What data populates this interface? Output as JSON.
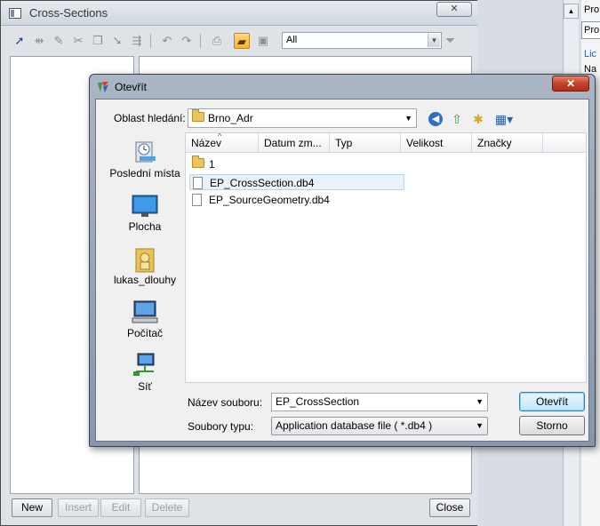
{
  "bg_window": {
    "title": "Cross-Sections",
    "close_glyph": "✕",
    "filter_value": "All",
    "buttons": {
      "new": "New",
      "insert": "Insert",
      "edit": "Edit",
      "delete": "Delete",
      "close": "Close"
    }
  },
  "right_panel": {
    "items": [
      "Pro",
      "Pro",
      "Lic",
      "Na"
    ]
  },
  "dialog": {
    "title": "Otevřít",
    "close_glyph": "✕",
    "look_in_label": "Oblast hledání:",
    "look_in_value": "Brno_Adr",
    "places": [
      {
        "label": "Poslední místa",
        "icon": "recent-places-icon"
      },
      {
        "label": "Plocha",
        "icon": "desktop-icon"
      },
      {
        "label": "lukas_dlouhy",
        "icon": "user-folder-icon"
      },
      {
        "label": "Počítač",
        "icon": "computer-icon"
      },
      {
        "label": "Síť",
        "icon": "network-icon"
      }
    ],
    "columns": [
      "Název",
      "Datum zm...",
      "Typ",
      "Velikost",
      "Značky"
    ],
    "files": [
      {
        "name": "1",
        "type": "folder"
      },
      {
        "name": "EP_CrossSection.db4",
        "type": "file",
        "selected": true
      },
      {
        "name": "EP_SourceGeometry.db4",
        "type": "file"
      }
    ],
    "file_name_label": "Název souboru:",
    "file_name_value": "EP_CrossSection",
    "file_type_label": "Soubory typu:",
    "file_type_value": "Application database file ( *.db4 )",
    "open_button": "Otevřít",
    "cancel_button": "Storno"
  }
}
